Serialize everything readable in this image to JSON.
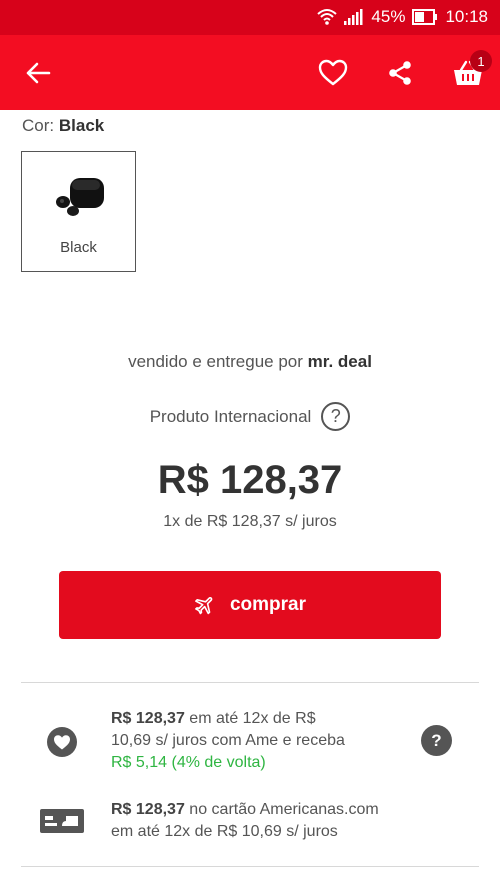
{
  "status_bar": {
    "battery": "45%",
    "time": "10:18"
  },
  "header": {
    "cart_count": "1"
  },
  "color": {
    "label": "Cor:",
    "value": "Black"
  },
  "swatch": {
    "name": "Black"
  },
  "seller": {
    "prefix": "vendido e entregue por",
    "name": "mr. deal"
  },
  "international": {
    "label": "Produto Internacional",
    "help": "?"
  },
  "price": {
    "main": "R$ 128,37",
    "installments": "1x de R$ 128,37 s/ juros"
  },
  "buy_button": {
    "label": "comprar"
  },
  "offers": [
    {
      "bold": "R$ 128,37",
      "line1_rest": "em até 12x de R$",
      "line2": "10,69 s/ juros com Ame e receba",
      "line3": "R$ 5,14 (4% de volta)",
      "help": "?"
    },
    {
      "bold": "R$ 128,37",
      "line1_rest": "no cartão Americanas.com",
      "line2": "em até 12x de R$ 10,69 s/ juros"
    }
  ],
  "colors": {
    "brand_red": "#f30d22",
    "status_red": "#d7021a",
    "button_red": "#e30b1e",
    "cashback_green": "#2fb542"
  }
}
